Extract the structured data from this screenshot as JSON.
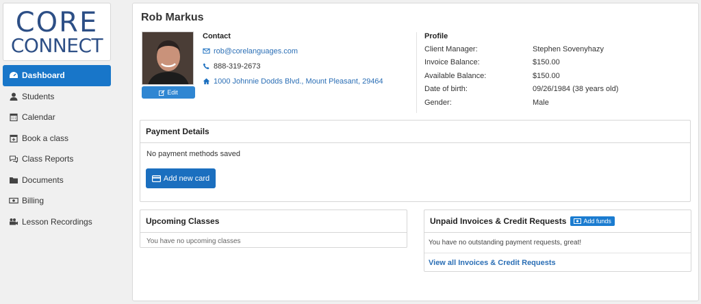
{
  "brand": {
    "line1": "CORE",
    "line2": "CONNECT",
    "color": "#2d4f86"
  },
  "sidebar": {
    "items": [
      {
        "label": "Dashboard",
        "icon": "dashboard-icon",
        "active": true
      },
      {
        "label": "Students",
        "icon": "user-icon"
      },
      {
        "label": "Calendar",
        "icon": "calendar-icon"
      },
      {
        "label": "Book a class",
        "icon": "calendar-plus-icon"
      },
      {
        "label": "Class Reports",
        "icon": "comments-icon"
      },
      {
        "label": "Documents",
        "icon": "folder-icon"
      },
      {
        "label": "Billing",
        "icon": "money-icon"
      },
      {
        "label": "Lesson Recordings",
        "icon": "video-camera-icon"
      }
    ]
  },
  "user": {
    "name": "Rob Markus",
    "edit_label": "Edit"
  },
  "contact": {
    "title": "Contact",
    "email": "rob@corelanguages.com",
    "phone": "888-319-2673",
    "address": "1000 Johnnie Dodds Blvd., Mount Pleasant, 29464"
  },
  "profile": {
    "title": "Profile",
    "rows": [
      {
        "key": "Client Manager:",
        "value": "Stephen Sovenyhazy"
      },
      {
        "key": "Invoice Balance:",
        "value": "$150.00"
      },
      {
        "key": "Available Balance:",
        "value": "$150.00"
      },
      {
        "key": "Date of birth:",
        "value": "09/26/1984 (38 years old)"
      },
      {
        "key": "Gender:",
        "value": "Male"
      }
    ]
  },
  "payment": {
    "title": "Payment Details",
    "empty_text": "No payment methods saved",
    "add_card_label": "Add new card"
  },
  "upcoming": {
    "title": "Upcoming Classes",
    "empty_text": "You have no upcoming classes"
  },
  "unpaid": {
    "title": "Unpaid Invoices & Credit Requests",
    "add_funds_label": "Add funds",
    "empty_text": "You have no outstanding payment requests, great!",
    "view_all_label": "View all Invoices & Credit Requests"
  },
  "colors": {
    "primary": "#1876c9",
    "link": "#2a6eb5"
  }
}
